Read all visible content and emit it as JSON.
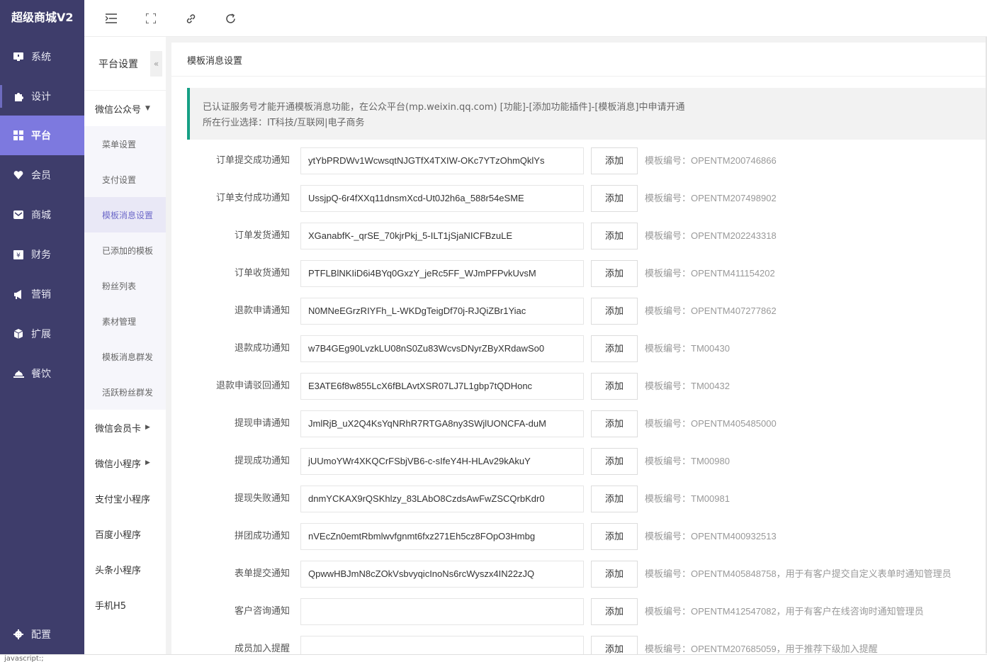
{
  "brand": "超级商城V2",
  "nav": [
    {
      "label": "系统",
      "icon": "monitor-icon"
    },
    {
      "label": "设计",
      "icon": "puzzle-icon"
    },
    {
      "label": "平台",
      "icon": "grid-icon"
    },
    {
      "label": "会员",
      "icon": "heart-icon"
    },
    {
      "label": "商城",
      "icon": "mail-icon"
    },
    {
      "label": "财务",
      "icon": "yen-icon"
    },
    {
      "label": "营销",
      "icon": "megaphone-icon"
    },
    {
      "label": "扩展",
      "icon": "cube-icon"
    },
    {
      "label": "餐饮",
      "icon": "cloche-icon"
    }
  ],
  "nav_bottom": {
    "label": "配置",
    "icon": "gear-icon"
  },
  "subbar": {
    "title": "平台设置",
    "collapse": "«",
    "group_wechat": "微信公众号",
    "items": [
      "菜单设置",
      "支付设置",
      "模板消息设置",
      "已添加的模板",
      "粉丝列表",
      "素材管理",
      "模板消息群发",
      "活跃粉丝群发"
    ],
    "groups_after": [
      "微信会员卡",
      "微信小程序",
      "支付宝小程序",
      "百度小程序",
      "头条小程序",
      "手机H5"
    ]
  },
  "main": {
    "title": "模板消息设置",
    "notice_line1": "已认证服务号才能开通模板消息功能，在公众平台(mp.weixin.qq.com) [功能]-[添加功能插件]-[模板消息]中申请开通",
    "notice_line2": "所在行业选择：IT科技/互联网|电子商务",
    "add_label": "添加",
    "rows": [
      {
        "label": "订单提交成功通知",
        "value": "ytYbPRDWv1WcwsqtNJGTfX4TXIW-OKc7YTzOhmQklYs",
        "code": "模板编号：OPENTM200746866"
      },
      {
        "label": "订单支付成功通知",
        "value": "UssjpQ-6r4fXXq11dnsmXcd-Ut0J2h6a_588r54eSME",
        "code": "模板编号：OPENTM207498902"
      },
      {
        "label": "订单发货通知",
        "value": "XGanabfK-_qrSE_70kjrPkj_5-ILT1jSjaNICFBzuLE",
        "code": "模板编号：OPENTM202243318"
      },
      {
        "label": "订单收货通知",
        "value": "PTFLBlNKIiD6i4BYq0GxzY_jeRc5FF_WJmPFPvkUvsM",
        "code": "模板编号：OPENTM411154202"
      },
      {
        "label": "退款申请通知",
        "value": "N0MNeEGrzRIYFh_L-WKDgTeigDf70j-RJQiZBr1Yiac",
        "code": "模板编号：OPENTM407277862"
      },
      {
        "label": "退款成功通知",
        "value": "w7B4GEg90LvzkLU08nS0Zu83WcvsDNyrZByXRdawSo0",
        "code": "模板编号：TM00430"
      },
      {
        "label": "退款申请驳回通知",
        "value": "E3ATE6f8w855LcX6fBLAvtXSR07LJ7L1gbp7tQDHonc",
        "code": "模板编号：TM00432"
      },
      {
        "label": "提现申请通知",
        "value": "JmlRjB_uX2Q4KsYqNRhR7RTGA8ny3SWjlUONCFA-duM",
        "code": "模板编号：OPENTM405485000"
      },
      {
        "label": "提现成功通知",
        "value": "jUUmoYWr4XKQCrFSbjVB6-c-sIfeY4H-HLAv29kAkuY",
        "code": "模板编号：TM00980"
      },
      {
        "label": "提现失败通知",
        "value": "dnmYCKAX9rQSKhlzy_83LAbO8CzdsAwFwZSCQrbKdr0",
        "code": "模板编号：TM00981"
      },
      {
        "label": "拼团成功通知",
        "value": "nVEcZn0emtRbmlwvfgnmt6fxz271Eh5cz8FOpO3Hmbg",
        "code": "模板编号：OPENTM400932513"
      },
      {
        "label": "表单提交通知",
        "value": "QpwwHBJmN8cZOkVsbvyqicInoNs6rcWyszx4IN22zJQ",
        "code": "模板编号：OPENTM405848758，用于有客户提交自定义表单时通知管理员"
      },
      {
        "label": "客户咨询通知",
        "value": "",
        "code": "模板编号：OPENTM412547082，用于有客户在线咨询时通知管理员"
      },
      {
        "label": "成员加入提醒",
        "value": "",
        "code": "模板编号：OPENTM207685059，用于推荐下级加入提醒"
      }
    ]
  },
  "statusbar": "javascript:;"
}
